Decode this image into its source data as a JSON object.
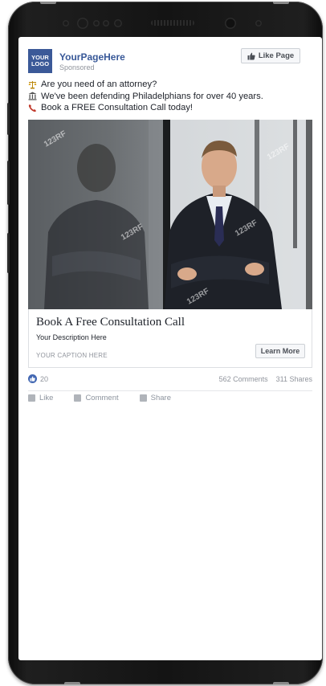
{
  "post": {
    "logo_line1": "YOUR",
    "logo_line2": "LOGO",
    "page_name": "YourPageHere",
    "sponsored": "Sponsored",
    "like_page_label": "Like Page",
    "text_lines": [
      {
        "icon": "scales-of-justice-icon",
        "text": "Are you need of an attorney?"
      },
      {
        "icon": "classical-building-icon",
        "text": "We've been defending Philadelphians for over 40 years."
      },
      {
        "icon": "telephone-icon",
        "text": "Book a FREE Consultation Call today!"
      }
    ]
  },
  "ad": {
    "image_alt": "businessman-photo",
    "watermark": "123RF",
    "headline": "Book A Free Consultation Call",
    "description": "Your Description Here",
    "caption": "YOUR CAPTION HERE",
    "cta_label": "Learn More"
  },
  "engagement": {
    "likes": "20",
    "comments": "562 Comments",
    "shares": "311 Shares",
    "actions": [
      "Like",
      "Comment",
      "Share"
    ]
  },
  "colors": {
    "brand": "#3b5998",
    "link": "#385898",
    "meta": "#90949c"
  }
}
